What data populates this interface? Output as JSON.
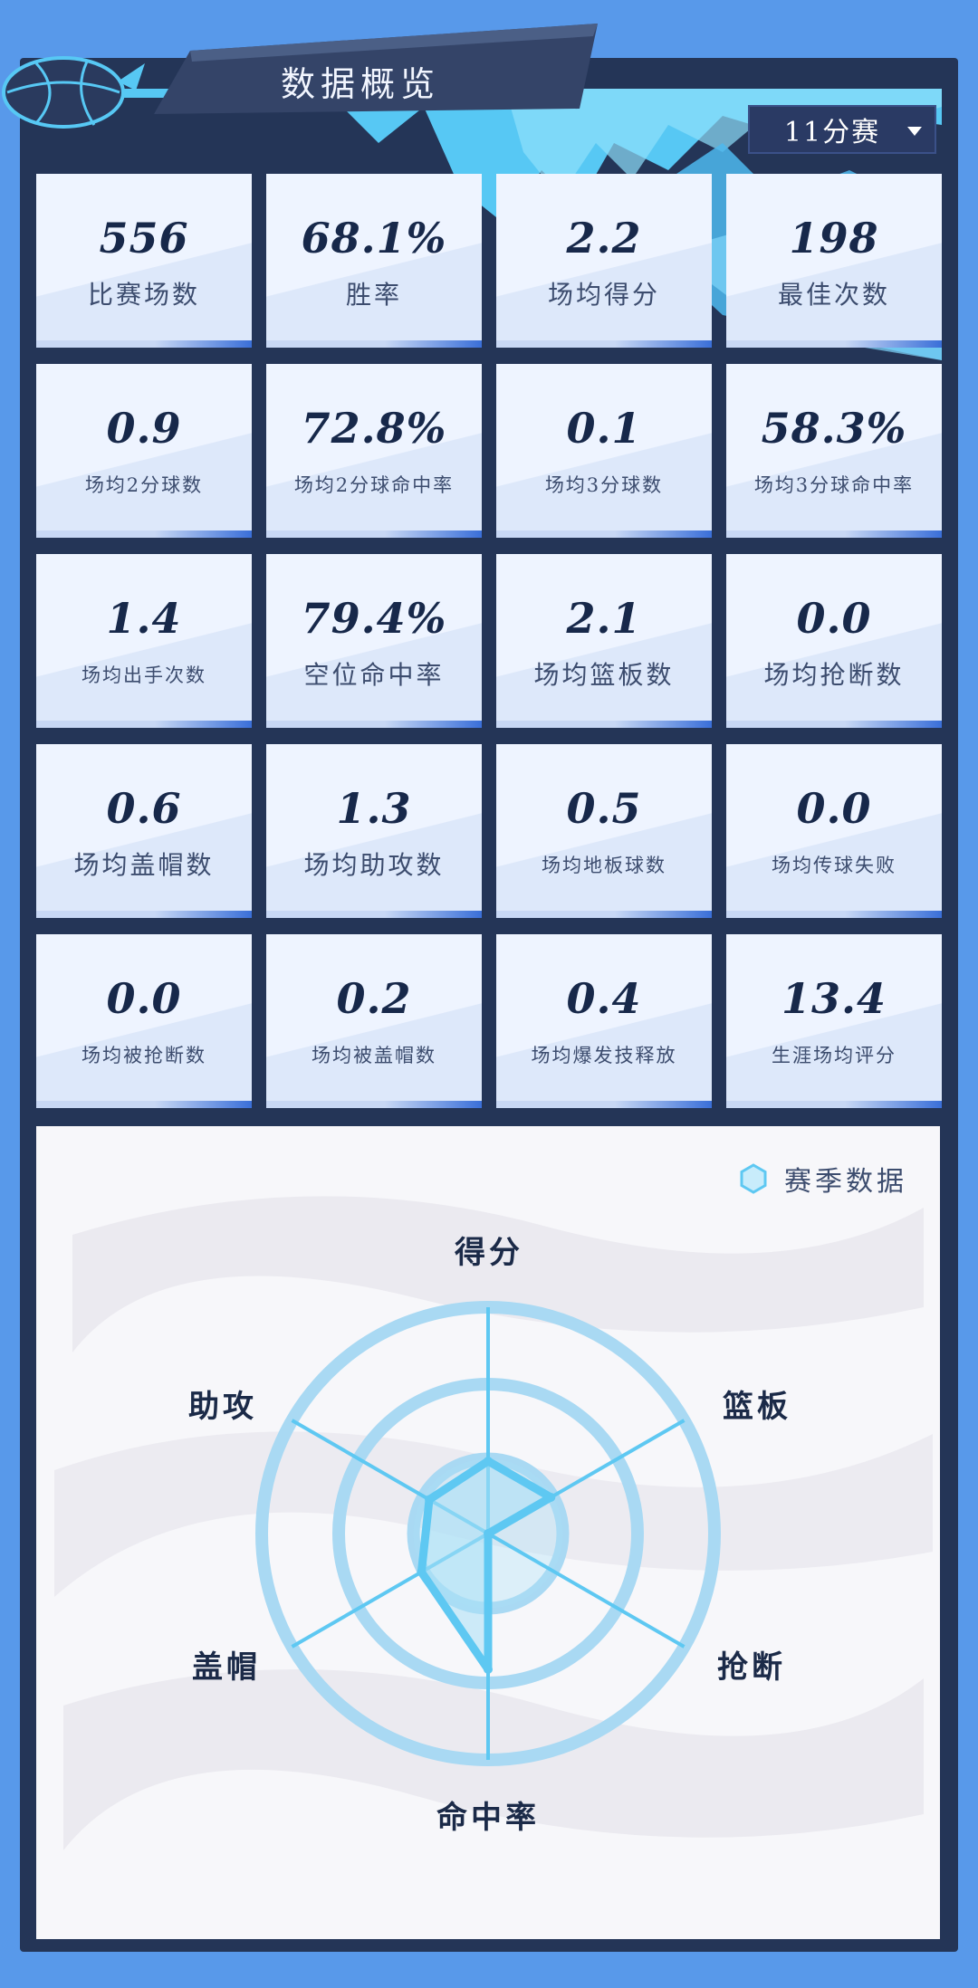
{
  "header": {
    "title": "数据概览",
    "season_select": "11分赛"
  },
  "stats": [
    {
      "value": "556",
      "label": "比赛场数"
    },
    {
      "value": "68.1%",
      "label": "胜率"
    },
    {
      "value": "2.2",
      "label": "场均得分"
    },
    {
      "value": "198",
      "label": "最佳次数"
    },
    {
      "value": "0.9",
      "label": "场均2分球数"
    },
    {
      "value": "72.8%",
      "label": "场均2分球命中率"
    },
    {
      "value": "0.1",
      "label": "场均3分球数"
    },
    {
      "value": "58.3%",
      "label": "场均3分球命中率"
    },
    {
      "value": "1.4",
      "label": "场均出手次数"
    },
    {
      "value": "79.4%",
      "label": "空位命中率"
    },
    {
      "value": "2.1",
      "label": "场均篮板数"
    },
    {
      "value": "0.0",
      "label": "场均抢断数"
    },
    {
      "value": "0.6",
      "label": "场均盖帽数"
    },
    {
      "value": "1.3",
      "label": "场均助攻数"
    },
    {
      "value": "0.5",
      "label": "场均地板球数"
    },
    {
      "value": "0.0",
      "label": "场均传球失败"
    },
    {
      "value": "0.0",
      "label": "场均被抢断数"
    },
    {
      "value": "0.2",
      "label": "场均被盖帽数"
    },
    {
      "value": "0.4",
      "label": "场均爆发技释放"
    },
    {
      "value": "13.4",
      "label": "生涯场均评分"
    }
  ],
  "radar": {
    "legend": "赛季数据",
    "axes": [
      "得分",
      "篮板",
      "抢断",
      "命中率",
      "盖帽",
      "助攻"
    ],
    "values": [
      0.32,
      0.32,
      0.0,
      0.6,
      0.34,
      0.3
    ],
    "colors": {
      "ring": "#a9d9f3",
      "line": "#5ec8f2",
      "fill": "#a9e0f5"
    }
  }
}
